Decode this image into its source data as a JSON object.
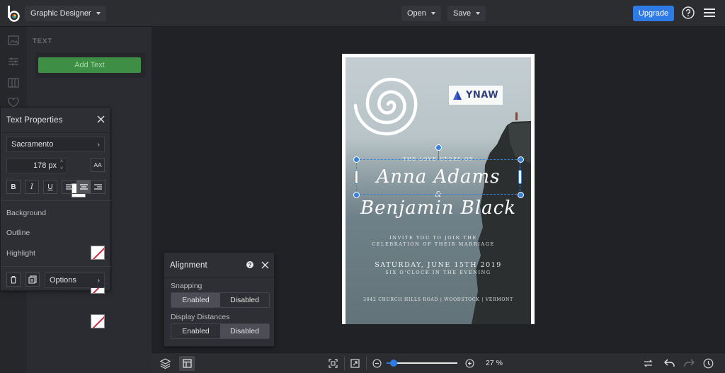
{
  "app": {
    "name_menu": "Graphic Designer"
  },
  "topbar": {
    "open_label": "Open",
    "save_label": "Save",
    "upgrade_label": "Upgrade"
  },
  "text_panel": {
    "section_title": "TEXT",
    "add_text_label": "Add Text"
  },
  "text_properties": {
    "title": "Text Properties",
    "font_name": "Sacramento",
    "size_value": "178 px",
    "bold": "B",
    "italic": "I",
    "underline": "U",
    "case_label": "AA",
    "alignment_selected": "center",
    "background_label": "Background",
    "outline_label": "Outline",
    "highlight_label": "Highlight",
    "options_label": "Options"
  },
  "alignment_panel": {
    "title": "Alignment",
    "snapping_label": "Snapping",
    "snapping_options": [
      "Enabled",
      "Disabled"
    ],
    "snapping_selected": "Enabled",
    "distances_label": "Display Distances",
    "distances_options": [
      "Enabled",
      "Disabled"
    ],
    "distances_selected": "Disabled"
  },
  "design": {
    "logo_text": "YNAW",
    "pretitle": "THE LOVE STORY OF",
    "name1": "Anna Adams",
    "amp": "&",
    "name2": "Benjamin Black",
    "invite_line1": "INVITE YOU TO JOIN THE",
    "invite_line2": "CELEBRATION OF THEIR MARRIAGE",
    "date_line": "SATURDAY, JUNE 15TH 2019",
    "time_line": "SIX O'CLOCK IN THE EVENING",
    "address_line": "3842 CHURCH HILLS ROAD | WOODSTOCK | VERMONT"
  },
  "bottombar": {
    "zoom_value": "27 %",
    "zoom_fraction": 0.27
  },
  "colors": {
    "accent": "#2f7be5",
    "add_text_green": "#3e8e46",
    "handle_blue": "#3a82d8"
  }
}
